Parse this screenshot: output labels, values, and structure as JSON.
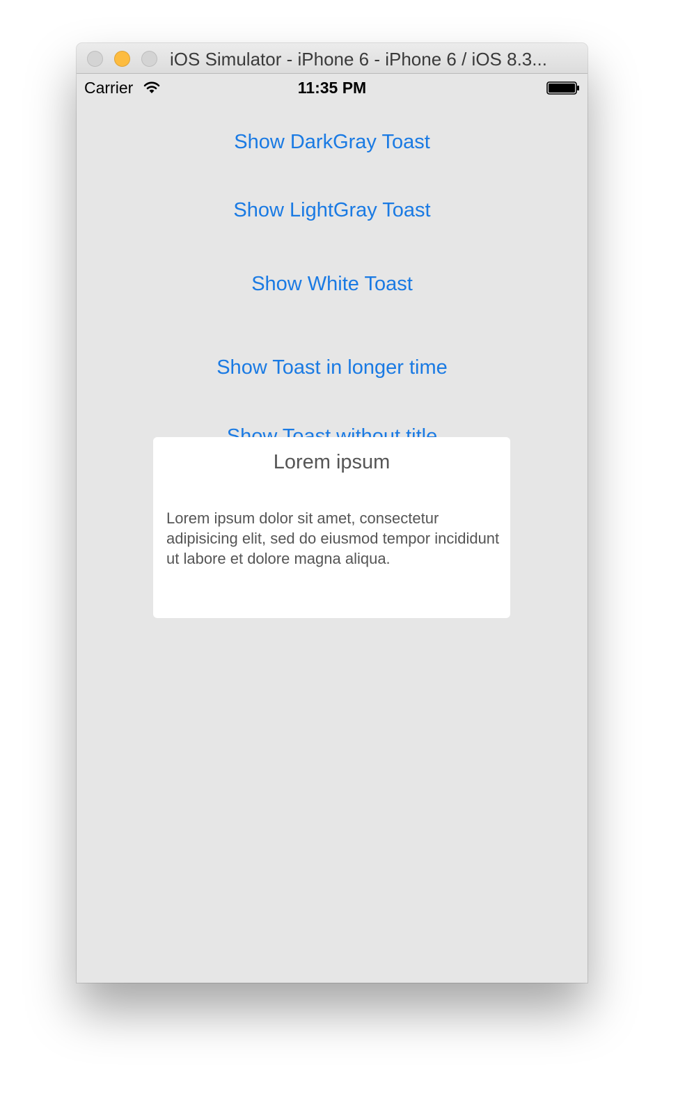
{
  "window": {
    "title": "iOS Simulator - iPhone 6 - iPhone 6 / iOS 8.3..."
  },
  "status_bar": {
    "carrier": "Carrier",
    "time": "11:35 PM",
    "icons": [
      "wifi-icon",
      "battery-icon"
    ]
  },
  "buttons": [
    {
      "label": "Show DarkGray Toast"
    },
    {
      "label": "Show LightGray Toast"
    },
    {
      "label": "Show White Toast"
    },
    {
      "label": "Show Toast in longer time"
    },
    {
      "label": "Show Toast without title"
    }
  ],
  "toast": {
    "title": "Lorem ipsum",
    "message": "Lorem ipsum dolor sit amet, consectetur adipisicing elit, sed do eiusmod tempor incididunt ut labore et dolore magna aliqua."
  },
  "colors": {
    "button_tint": "#1a7ae3",
    "screen_background": "#e6e6e6",
    "toast_background": "#ffffff",
    "toast_text": "#555555"
  }
}
